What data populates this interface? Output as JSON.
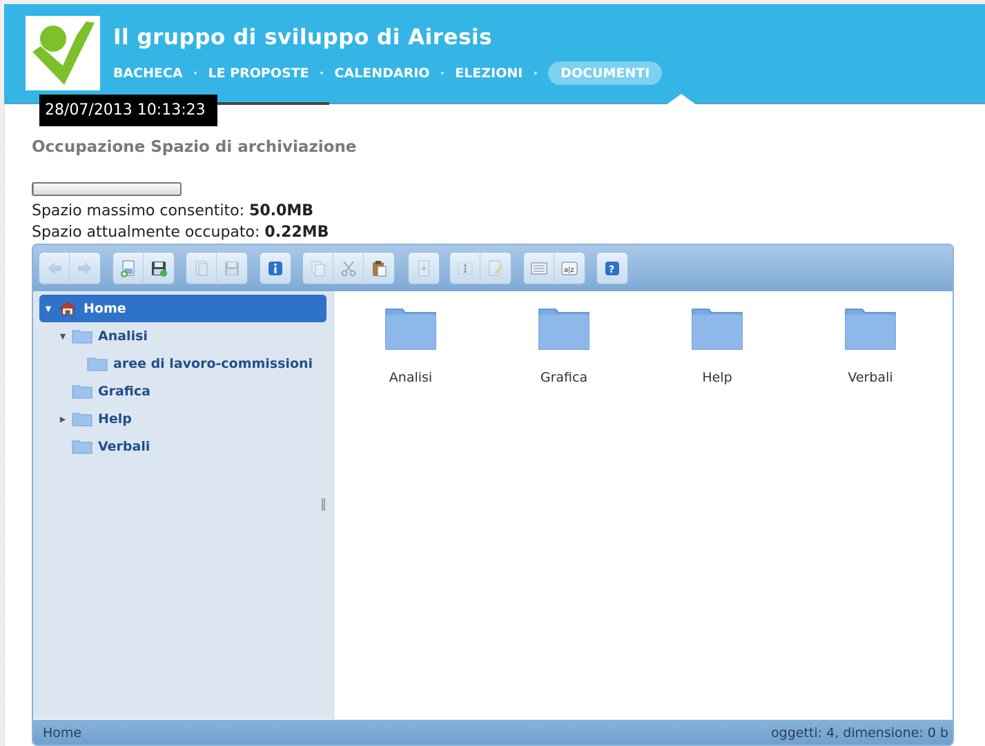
{
  "header": {
    "title": "Il gruppo di sviluppo di Airesis",
    "nav": [
      {
        "label": "BACHECA"
      },
      {
        "label": "LE PROPOSTE"
      },
      {
        "label": "CALENDARIO"
      },
      {
        "label": "ELEZIONI"
      },
      {
        "label": "DOCUMENTI"
      }
    ],
    "separator": "·",
    "active_nav": "DOCUMENTI",
    "colors": {
      "bar": "#35b5e5",
      "logo_green": "#7cc12a"
    }
  },
  "timestamp": "28/07/2013 10:13:23",
  "quota": {
    "title": "Occupazione Spazio di archiviazione",
    "used_fraction": 0.0044,
    "max_label": "Spazio massimo consentito:",
    "max_value": "50.0MB",
    "used_label": "Spazio attualmente occupato:",
    "used_value": "0.22MB"
  },
  "file_manager": {
    "toolbar_groups": [
      [
        {
          "icon": "back-icon",
          "disabled": true
        },
        {
          "icon": "forward-icon",
          "disabled": true
        }
      ],
      [
        {
          "icon": "open-file-icon",
          "disabled": false
        },
        {
          "icon": "save-icon",
          "disabled": false
        }
      ],
      [
        {
          "icon": "duplicate-icon",
          "disabled": true
        },
        {
          "icon": "save-disk-icon",
          "disabled": true
        }
      ],
      [
        {
          "icon": "info-icon",
          "disabled": false
        }
      ],
      [
        {
          "icon": "copy-icon",
          "disabled": true
        },
        {
          "icon": "cut-icon",
          "disabled": true
        },
        {
          "icon": "paste-icon",
          "disabled": false
        }
      ],
      [
        {
          "icon": "extract-icon",
          "disabled": true
        }
      ],
      [
        {
          "icon": "rename-icon",
          "disabled": true
        },
        {
          "icon": "edit-icon",
          "disabled": true
        }
      ],
      [
        {
          "icon": "list-view-icon",
          "disabled": false
        },
        {
          "icon": "sort-icon",
          "disabled": false
        }
      ],
      [
        {
          "icon": "help-icon",
          "disabled": false
        }
      ]
    ],
    "tree": {
      "home": "Home",
      "items": [
        {
          "label": "Analisi",
          "expanded": true
        },
        {
          "label": "aree di lavoro-commissioni"
        },
        {
          "label": "Grafica"
        },
        {
          "label": "Help",
          "collapsed": true
        },
        {
          "label": "Verbali"
        }
      ]
    },
    "files": [
      {
        "label": "Analisi"
      },
      {
        "label": "Grafica"
      },
      {
        "label": "Help"
      },
      {
        "label": "Verbali"
      }
    ],
    "status": {
      "path": "Home",
      "info": "oggetti: 4, dimensione: 0 b"
    }
  }
}
